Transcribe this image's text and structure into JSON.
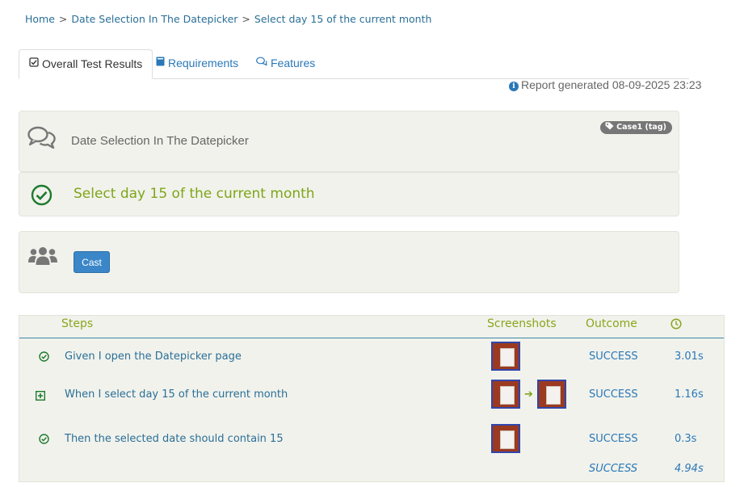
{
  "breadcrumb": {
    "home": "Home",
    "parent": "Date Selection In The Datepicker",
    "current": "Select day 15 of the current month",
    "separator": ">"
  },
  "tabs": [
    {
      "label": "Overall Test Results",
      "icon": "checkbox-icon",
      "active": true
    },
    {
      "label": "Requirements",
      "icon": "book-icon",
      "active": false
    },
    {
      "label": "Features",
      "icon": "comments-icon",
      "active": false
    }
  ],
  "report": {
    "generated": "Report generated 08-09-2025 23:23"
  },
  "feature": {
    "title": "Date Selection In The Datepicker",
    "tag": "Case1 (tag)"
  },
  "scenario": {
    "title": "Select day 15 of the current month",
    "status_icon": "success-check-icon"
  },
  "cast": {
    "button_label": "Cast",
    "icon": "users-icon"
  },
  "steps": {
    "headers": {
      "steps": "Steps",
      "screenshots": "Screenshots",
      "outcome": "Outcome",
      "duration_icon": "clock-icon"
    },
    "rows": [
      {
        "text": "Given I open the Datepicker page",
        "outcome": "SUCCESS",
        "duration": "3.01s",
        "screenshots": 1,
        "icon": "check-circle-icon"
      },
      {
        "text": "When I select day 15 of the current month",
        "outcome": "SUCCESS",
        "duration": "1.16s",
        "screenshots": 2,
        "icon": "expand-plus-icon"
      },
      {
        "text": "Then the selected date should contain 15",
        "outcome": "SUCCESS",
        "duration": "0.3s",
        "screenshots": 1,
        "icon": "check-circle-icon"
      }
    ],
    "total": {
      "outcome": "SUCCESS",
      "duration": "4.94s"
    }
  },
  "colors": {
    "accent_green": "#7ea518",
    "link_blue": "#2a78b8",
    "panel_bg": "#f1f2ec"
  }
}
